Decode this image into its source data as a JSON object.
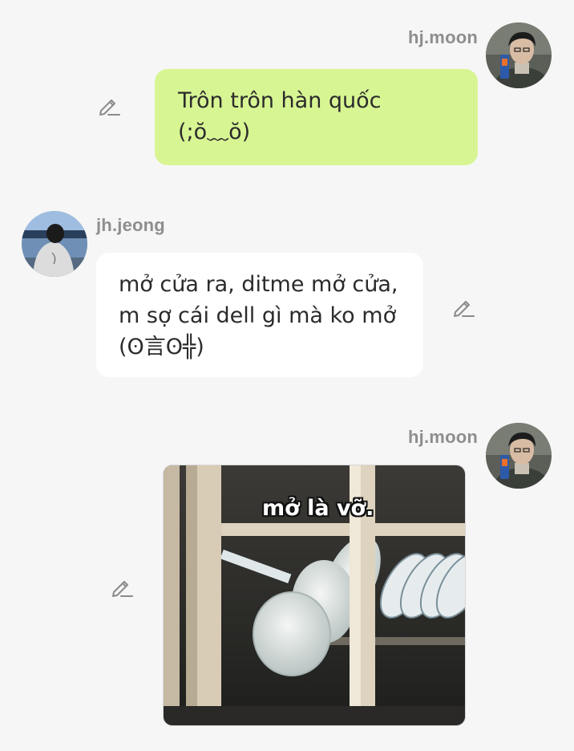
{
  "messages": [
    {
      "sender": "hj.moon",
      "side": "right",
      "type": "text",
      "lines": [
        "Trôn trôn hàn quốc",
        "(;ŏ﹏ŏ)"
      ],
      "bubble_color": "#d8f594"
    },
    {
      "sender": "jh.jeong",
      "side": "left",
      "type": "text",
      "lines": [
        "mở cửa ra, ditme mở cửa,",
        "m sợ cái dell gì mà ko mở",
        "(ʘ言ʘ╬)"
      ],
      "bubble_color": "#ffffff"
    },
    {
      "sender": "hj.moon",
      "side": "right",
      "type": "image",
      "image_caption": "mở là vỡ."
    }
  ],
  "icons": {
    "edit": "pencil-edit-icon"
  },
  "colors": {
    "background": "#f6f6f6",
    "sent_bubble": "#d8f594",
    "received_bubble": "#ffffff",
    "name_text": "#8e8e8e"
  }
}
